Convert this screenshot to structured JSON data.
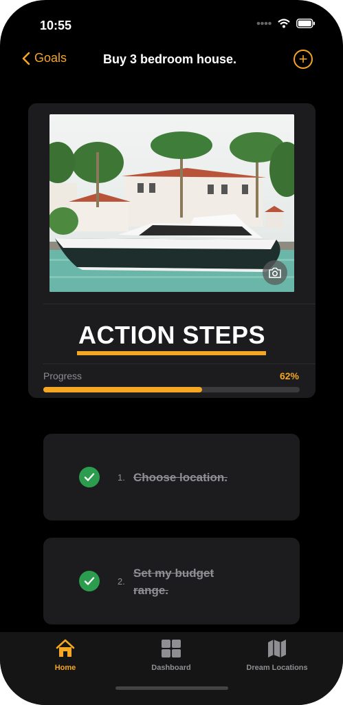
{
  "status": {
    "time": "10:55"
  },
  "nav": {
    "back_label": "Goals",
    "title": "Buy 3 bedroom house."
  },
  "card": {
    "heading": "ACTION STEPS",
    "progress_label": "Progress",
    "progress_text": "62%",
    "progress_fraction": 0.62
  },
  "steps": [
    {
      "number": "1.",
      "text": "Choose location.",
      "done": true
    },
    {
      "number": "2.",
      "text": "Set my budget range.",
      "done": true
    }
  ],
  "tabs": [
    {
      "label": "Home",
      "icon": "house-icon",
      "active": true
    },
    {
      "label": "Dashboard",
      "icon": "grid-icon",
      "active": false
    },
    {
      "label": "Dream Locations",
      "icon": "map-icon",
      "active": false
    }
  ],
  "colors": {
    "accent": "#f5a623",
    "check": "#2c9c4e",
    "background": "#000000",
    "card": "#1c1c1e"
  }
}
